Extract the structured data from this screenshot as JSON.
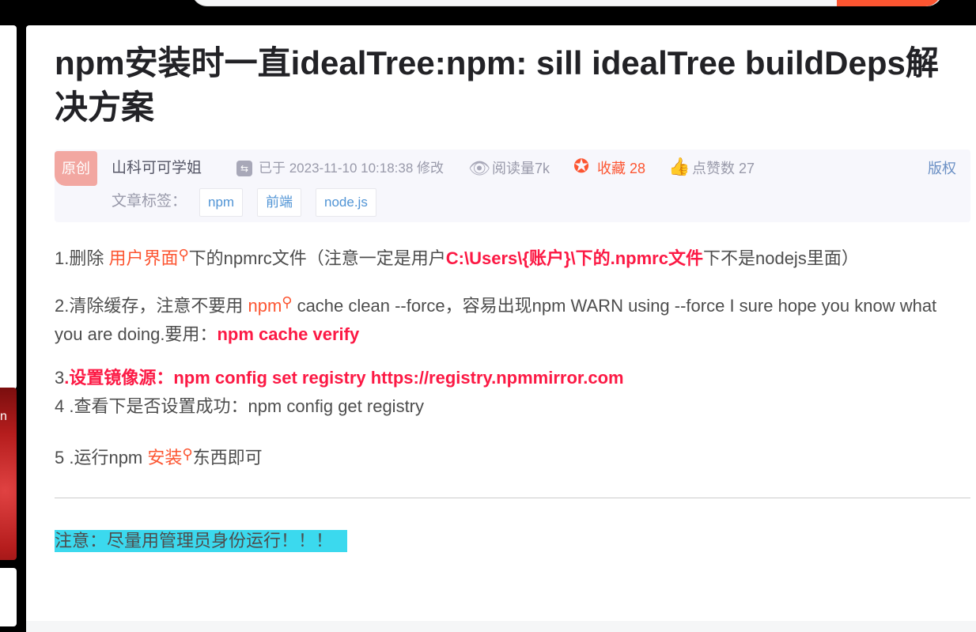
{
  "article": {
    "title": "npm安装时一直idealTree:npm: sill idealTree buildDeps解决方案",
    "original_badge": "原创",
    "author": "山科可可学姐",
    "edit_time": "已于 2023-11-10 10:18:38 修改",
    "read_count": "阅读量7k",
    "favorites": "收藏 28",
    "likes": "点赞数 27",
    "copyright": "版权",
    "tags_label": "文章标签：",
    "tags": [
      "npm",
      "前端",
      "node.js"
    ]
  },
  "content": {
    "p1": {
      "a": "1.删除 ",
      "link": "用户界面",
      "b": "下的npmrc文件（注意一定是用户",
      "red": "C:\\Users\\{账户}\\下的.npmrc文件",
      "c": "下不是nodejs里面）"
    },
    "p2": {
      "a": "2.清除缓存，注意不要用 ",
      "link": "npm",
      "b": " cache clean --force，容易出现npm WARN using --force I sure hope you know what you are doing.要用：",
      "red": "npm cache verify"
    },
    "p3": {
      "a": " 3",
      "red": ".设置镜像源：npm config set registry https://registry.npmmirror.com"
    },
    "p4": " 4 .查看下是否设置成功：npm config get registry",
    "p5": {
      "a": " 5 .运行npm  ",
      "link": "安装",
      "b": "东西即可"
    },
    "note": "注意：尽量用管理员身份运行！！！"
  },
  "sidebar_ad_text": "n",
  "icons": [
    "edit-icon",
    "eye-icon",
    "favorite-icon",
    "like-icon",
    "search-keyword-icon"
  ],
  "colors": {
    "accent": "#fc5531",
    "emphasis_red": "#fc1944",
    "tag_blue": "#5094d5",
    "note_highlight": "#3bd9ee",
    "badge_pink": "#f2a7a1"
  }
}
